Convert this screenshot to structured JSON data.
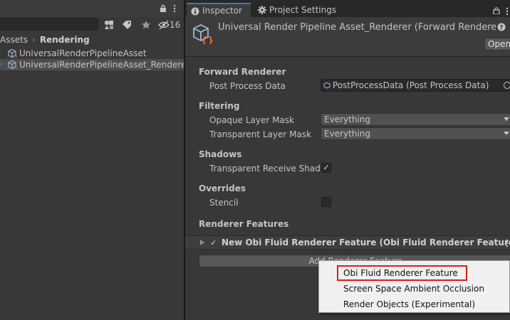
{
  "project": {
    "hidden_count": "16",
    "breadcrumb": [
      "Assets",
      "Rendering"
    ],
    "assets": [
      {
        "label": "UniversalRenderPipelineAsset",
        "selected": false
      },
      {
        "label": "UniversalRenderPipelineAsset_Renderer",
        "selected": true
      }
    ]
  },
  "tabs": [
    {
      "label": "Inspector",
      "icon": "info-icon"
    },
    {
      "label": "Project Settings",
      "icon": "gear-icon"
    }
  ],
  "inspector": {
    "title": "Universal Render Pipeline Asset_Renderer (Forward Rendere",
    "open_label": "Open",
    "sections": {
      "forward": "Forward Renderer",
      "filtering": "Filtering",
      "shadows": "Shadows",
      "overrides": "Overrides",
      "features": "Renderer Features"
    },
    "post_process_label": "Post Process Data",
    "post_process_value": "PostProcessData (Post Process Data)",
    "opaque_label": "Opaque Layer Mask",
    "opaque_value": "Everything",
    "transparent_label": "Transparent Layer Mask",
    "transparent_value": "Everything",
    "receive_shadows_label": "Transparent Receive Shado",
    "receive_shadows_checked": true,
    "stencil_label": "Stencil",
    "stencil_checked": false,
    "feature_label": "New Obi Fluid Renderer Feature (Obi Fluid Renderer Feature)",
    "add_feature_label": "Add Renderer Feature"
  },
  "menu": {
    "items": [
      "Obi Fluid Renderer Feature",
      "Screen Space Ambient Occlusion",
      "Render Objects (Experimental)"
    ],
    "highlight_color": "#e01b1b"
  }
}
